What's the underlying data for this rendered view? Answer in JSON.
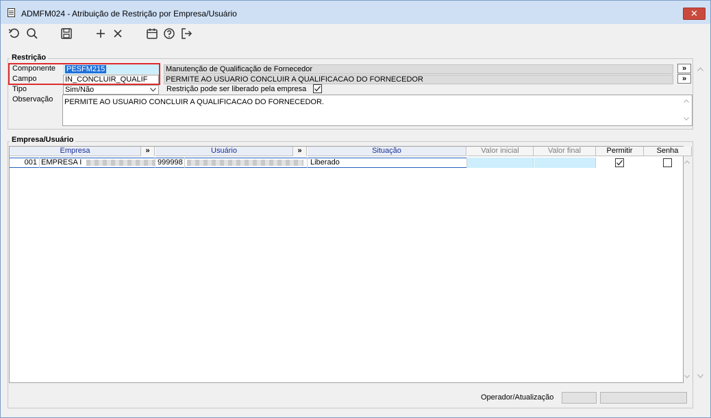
{
  "window": {
    "title": "ADMFM024 - Atribuição de Restrição por Empresa/Usuário",
    "close_label": "✕"
  },
  "toolbar": {
    "buttons": [
      "refresh",
      "search",
      "save",
      "add",
      "delete",
      "calendar",
      "help",
      "exit"
    ]
  },
  "restricao": {
    "legend": "Restrição",
    "componente_label": "Componente",
    "componente_value": "PESFM215",
    "componente_desc": "Manutenção de Qualificação de Fornecedor",
    "campo_label": "Campo",
    "campo_value": "IN_CONCLUIR_QUALIF",
    "campo_desc": "PERMITE AO USUARIO CONCLUIR A QUALIFICACAO DO FORNECEDOR",
    "tipo_label": "Tipo",
    "tipo_value": "Sim/Não",
    "liberado_label": "Restrição pode ser liberado pela empresa",
    "liberado_checked": true,
    "observacao_label": "Observação",
    "observacao_value": "PERMITE AO USUARIO CONCLUIR A QUALIFICACAO DO FORNECEDOR.",
    "jump_label": "»"
  },
  "empresa_usuario": {
    "legend": "Empresa/Usuário",
    "columns": {
      "empresa": "Empresa",
      "usuario": "Usuário",
      "situacao": "Situação",
      "valor_inicial": "Valor inicial",
      "valor_final": "Valor final",
      "permitir": "Permitir",
      "senha": "Senha",
      "jump": "»"
    },
    "rows": [
      {
        "empresa_code": "001",
        "empresa_name": "EMPRESA I",
        "usuario_code": "999998",
        "situacao": "Liberado",
        "permitir": true,
        "senha": false
      }
    ]
  },
  "footer": {
    "operador_label": "Operador/Atualização"
  },
  "colors": {
    "titlebar": "#cfe0f5",
    "close": "#c94a3d",
    "highlight": "#e02b2b",
    "selection": "#1e6fd9",
    "header_text": "#1a2e9a"
  }
}
